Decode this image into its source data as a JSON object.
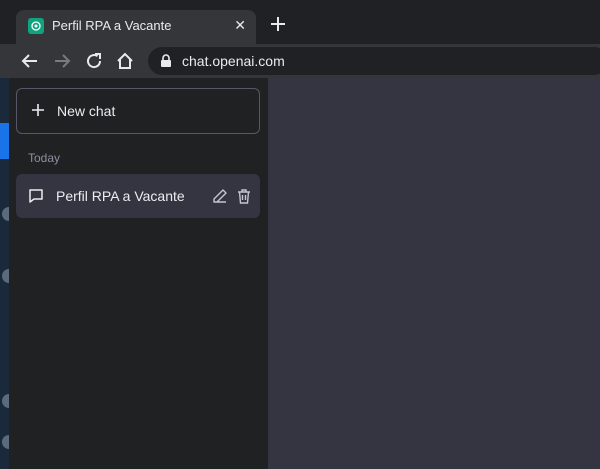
{
  "browser": {
    "tab_title": "Perfil RPA a Vacante",
    "tab_close": "✕",
    "new_tab": "+",
    "url": "chat.openai.com"
  },
  "sidebar": {
    "new_chat_label": "New chat",
    "section_label": "Today",
    "chats": [
      {
        "label": "Perfil RPA a Vacante"
      }
    ]
  },
  "colors": {
    "sidebar_bg": "#202123",
    "main_bg": "#343541",
    "accent": "#10a37f"
  }
}
